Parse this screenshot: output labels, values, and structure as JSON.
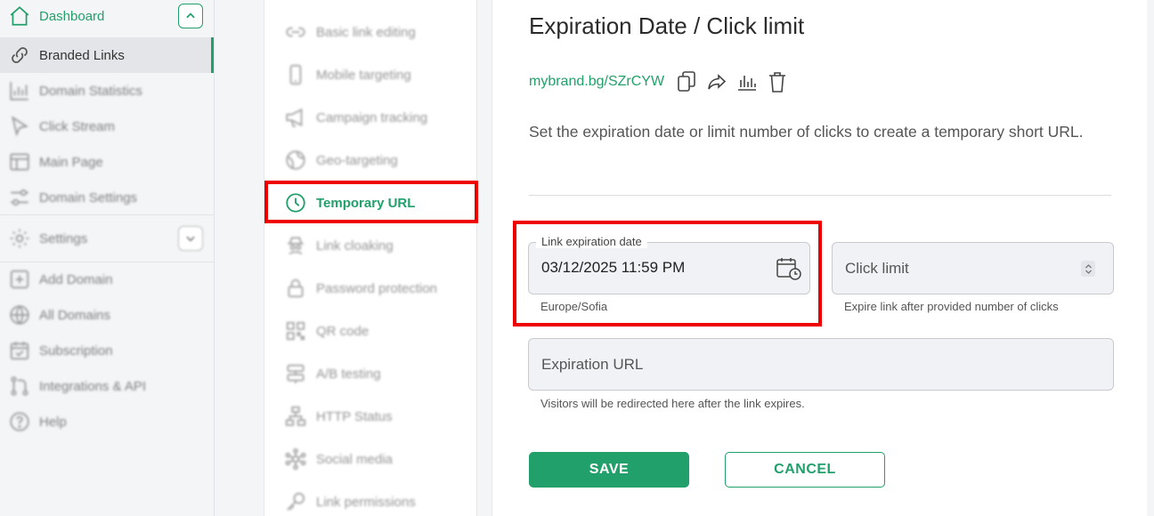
{
  "sidebar": {
    "dashboard": "Dashboard",
    "items": [
      {
        "label": "Branded Links",
        "icon": "link-icon"
      },
      {
        "label": "Domain Statistics",
        "icon": "stats-icon"
      },
      {
        "label": "Click Stream",
        "icon": "cursor-icon"
      },
      {
        "label": "Main Page",
        "icon": "layout-icon"
      },
      {
        "label": "Domain Settings",
        "icon": "sliders-icon"
      }
    ],
    "settings": "Settings",
    "bottom_items": [
      {
        "label": "Add Domain",
        "icon": "plus-square-icon"
      },
      {
        "label": "All Domains",
        "icon": "globe-icon"
      },
      {
        "label": "Subscription",
        "icon": "calendar-check-icon"
      },
      {
        "label": "Integrations & API",
        "icon": "git-icon"
      },
      {
        "label": "Help",
        "icon": "help-icon"
      }
    ]
  },
  "menu": {
    "items": [
      {
        "label": "Basic link editing",
        "icon": "link-icon"
      },
      {
        "label": "Mobile targeting",
        "icon": "mobile-icon"
      },
      {
        "label": "Campaign tracking",
        "icon": "megaphone-icon"
      },
      {
        "label": "Geo-targeting",
        "icon": "globe-icon"
      },
      {
        "label": "Temporary URL",
        "icon": "clock-icon",
        "active": true
      },
      {
        "label": "Link cloaking",
        "icon": "spy-icon"
      },
      {
        "label": "Password protection",
        "icon": "lock-icon"
      },
      {
        "label": "QR code",
        "icon": "qr-icon"
      },
      {
        "label": "A/B testing",
        "icon": "ab-icon"
      },
      {
        "label": "HTTP Status",
        "icon": "sitemap-icon"
      },
      {
        "label": "Social media",
        "icon": "network-icon"
      },
      {
        "label": "Link permissions",
        "icon": "key-icon"
      }
    ]
  },
  "main": {
    "title": "Expiration Date / Click limit",
    "short_link": "mybrand.bg/SZrCYW",
    "description": "Set the expiration date or limit number of clicks to create a temporary short URL.",
    "expiration": {
      "legend": "Link expiration date",
      "value": "03/12/2025 11:59 PM",
      "timezone": "Europe/Sofia"
    },
    "click_limit": {
      "placeholder": "Click limit",
      "hint": "Expire link after provided number of clicks"
    },
    "expiration_url": {
      "placeholder": "Expiration URL",
      "hint": "Visitors will be redirected here after the link expires."
    },
    "save_label": "SAVE",
    "cancel_label": "CANCEL"
  },
  "colors": {
    "accent": "#22a06b",
    "highlight": "#ee0000"
  }
}
